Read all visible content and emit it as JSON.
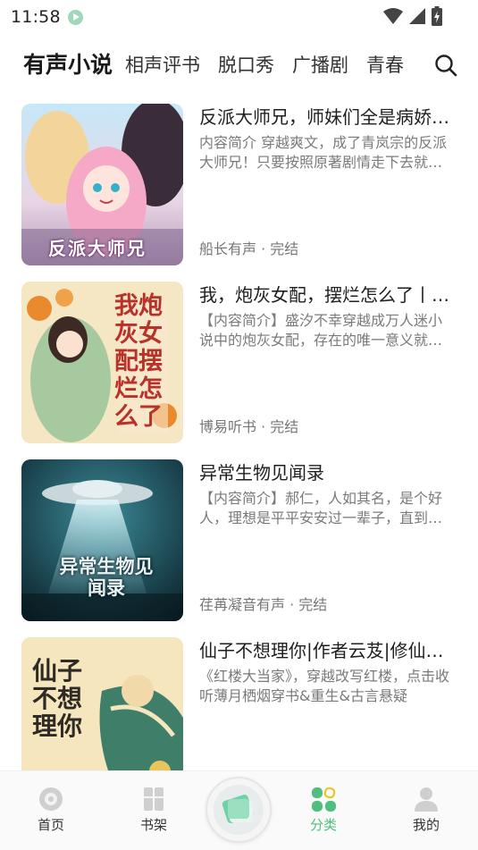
{
  "status_bar": {
    "time": "11:58",
    "app_icon": "play-icon",
    "icons": [
      "wifi-icon",
      "signal-icon",
      "battery-charging-icon"
    ]
  },
  "tabs": [
    {
      "label": "有声小说",
      "active": true
    },
    {
      "label": "相声评书",
      "active": false
    },
    {
      "label": "脱口秀",
      "active": false
    },
    {
      "label": "广播剧",
      "active": false
    },
    {
      "label": "青春",
      "active": false
    }
  ],
  "search": {
    "icon": "search-icon"
  },
  "books": [
    {
      "title": "反派大师兄，师妹们全是病娇（多人有声剧）",
      "desc": "内容简介 穿越爽文，成了青岚宗的反派大师兄！只要按照原著剧情走下去就能活命",
      "meta": "船长有声 · 完结",
      "cover_text": "反派大师兄",
      "cover_colors": [
        "#bfe3f6",
        "#f4b9cf",
        "#7a5a8a"
      ]
    },
    {
      "title": "我，炮灰女配，摆烂怎么了丨多人有声剧",
      "desc": "【内容简介】盛汐不幸穿越成万人迷小说中的炮灰女配，存在的唯一意义就是衬托女主",
      "meta": "博易听书 · 完结",
      "cover_text": "我炮灰女配摆烂怎么了",
      "cover_colors": [
        "#f6e6c0",
        "#e38a2c",
        "#b8322a"
      ]
    },
    {
      "title": "异常生物见闻录",
      "desc": "【内容简介】郝仁，人如其名，是个好人，理想是平平安安过一辈子，直到有一天",
      "meta": "荏苒凝音有声 · 完结",
      "cover_text": "异常生物见闻录",
      "cover_colors": [
        "#0d2a35",
        "#2c7d8a",
        "#b9e6ee"
      ]
    },
    {
      "title": "仙子不想理你|作者云芨|修仙言情",
      "desc": "《红楼大当家》，穿越改写红楼，点击收听薄月栖烟穿书&重生&古言悬疑",
      "meta": "",
      "cover_text": "仙子不想理你",
      "cover_colors": [
        "#f3e2b5",
        "#3f7f6a",
        "#c2342b"
      ]
    }
  ],
  "bottom_nav": [
    {
      "label": "首页",
      "icon": "disc-icon",
      "active": false
    },
    {
      "label": "书架",
      "icon": "bookshelf-icon",
      "active": false
    },
    {
      "label": "",
      "icon": "now-playing-icon",
      "active": false
    },
    {
      "label": "分类",
      "icon": "category-grid-icon",
      "active": true
    },
    {
      "label": "我的",
      "icon": "user-icon",
      "active": false
    }
  ],
  "colors": {
    "accent": "#4fbf7d",
    "inactive_icon": "#c9c9c9"
  }
}
